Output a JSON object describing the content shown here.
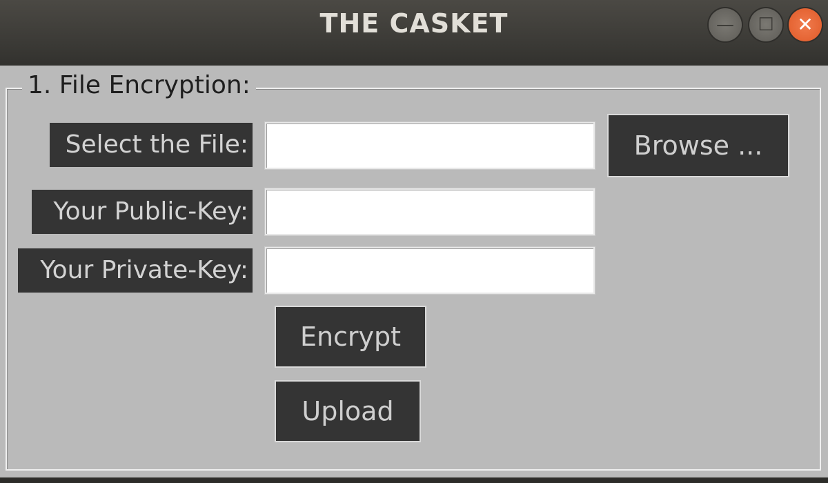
{
  "window": {
    "title": "THE CASKET",
    "controls": {
      "minimize_icon": "—",
      "maximize_icon": "☐",
      "close_icon": "✕"
    }
  },
  "section": {
    "title": "1. File Encryption:"
  },
  "fields": {
    "file_label": "Select the File:",
    "file_value": "",
    "public_key_label": "Your Public-Key:",
    "public_key_value": "",
    "private_key_label": "Your Private-Key:",
    "private_key_value": ""
  },
  "buttons": {
    "browse": "Browse ...",
    "encrypt": "Encrypt",
    "upload": "Upload"
  },
  "colors": {
    "titlebar": "#3a3935",
    "client_bg": "#bababa",
    "widget_dark": "#343434",
    "close_button": "#e05a28"
  }
}
